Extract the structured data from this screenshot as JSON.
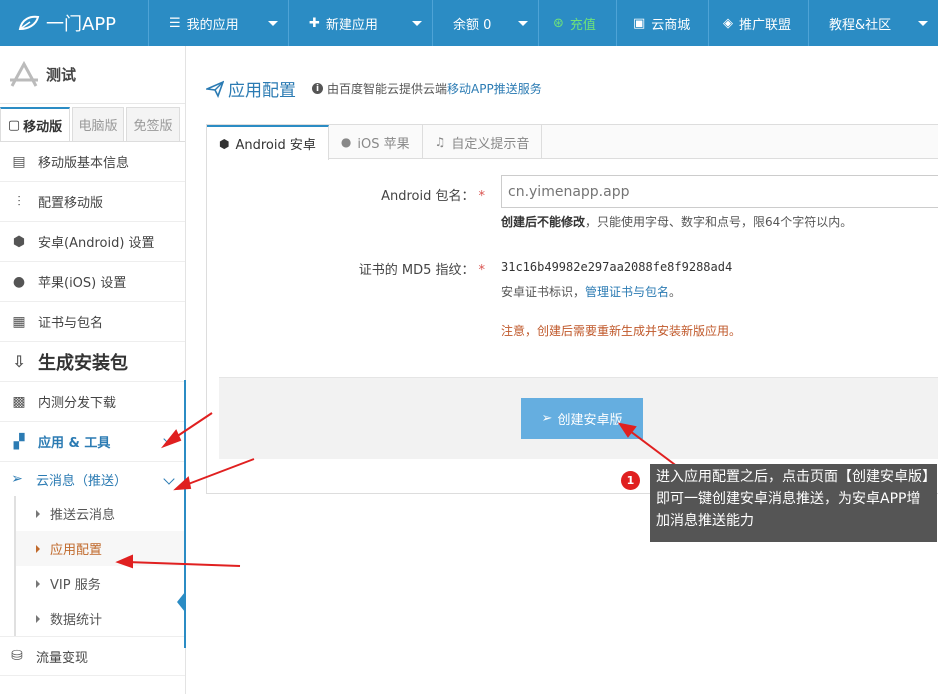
{
  "header": {
    "logo": "一门APP",
    "nav": [
      {
        "label": "我的应用",
        "icon": "list-icon"
      },
      {
        "label": "新建应用",
        "icon": "plus-icon"
      },
      {
        "label": "余额 0",
        "icon": ""
      },
      {
        "label": "充值",
        "icon": "yen-icon"
      },
      {
        "label": "云商城",
        "icon": "store-icon"
      },
      {
        "label": "推广联盟",
        "icon": "diamond-icon"
      },
      {
        "label": "教程&社区",
        "icon": ""
      }
    ]
  },
  "sidebar": {
    "app_name": "测试",
    "tabs": [
      "移动版",
      "电脑版",
      "免签版"
    ],
    "items": [
      {
        "label": "移动版基本信息"
      },
      {
        "label": "配置移动版"
      },
      {
        "label": "安卓(Android) 设置"
      },
      {
        "label": "苹果(iOS) 设置"
      },
      {
        "label": "证书与包名"
      },
      {
        "label": "生成安装包"
      },
      {
        "label": "内测分发下载"
      },
      {
        "label": "应用 & 工具"
      },
      {
        "label": "云消息（推送）"
      }
    ],
    "sub_items": [
      "推送云消息",
      "应用配置",
      "VIP 服务",
      "数据统计"
    ],
    "last_item": "流量变现"
  },
  "main": {
    "title": "应用配置",
    "info_prefix": "由百度智能云提供云端",
    "info_link": "移动APP推送服务",
    "tabs": [
      "Android 安卓",
      "iOS 苹果",
      "自定义提示音"
    ],
    "package_label": "Android 包名：",
    "package_placeholder": "cn.yimenapp.app",
    "package_hint_bold": "创建后不能修改",
    "package_hint": "，只能使用字母、数字和点号，限64个字符以内。",
    "md5_label": "证书的 MD5 指纹：",
    "md5_value": "31c16b49982e297aa2088fe8f9288ad4",
    "md5_hint_prefix": "安卓证书标识，",
    "md5_hint_link": "管理证书与包名",
    "md5_hint_suffix": "。",
    "warning": "注意，创建后需要重新生成并安装新版应用。",
    "create_button": "创建安卓版"
  },
  "callout": {
    "badge": "1",
    "text": "进入应用配置之后，点击页面【创建安卓版】即可一键创建安卓消息推送，为安卓APP增加消息推送能力"
  },
  "colors": {
    "brand": "#2b8cc4",
    "button": "#65aee0",
    "warning": "#c0592b",
    "annotation": "#e02020"
  }
}
